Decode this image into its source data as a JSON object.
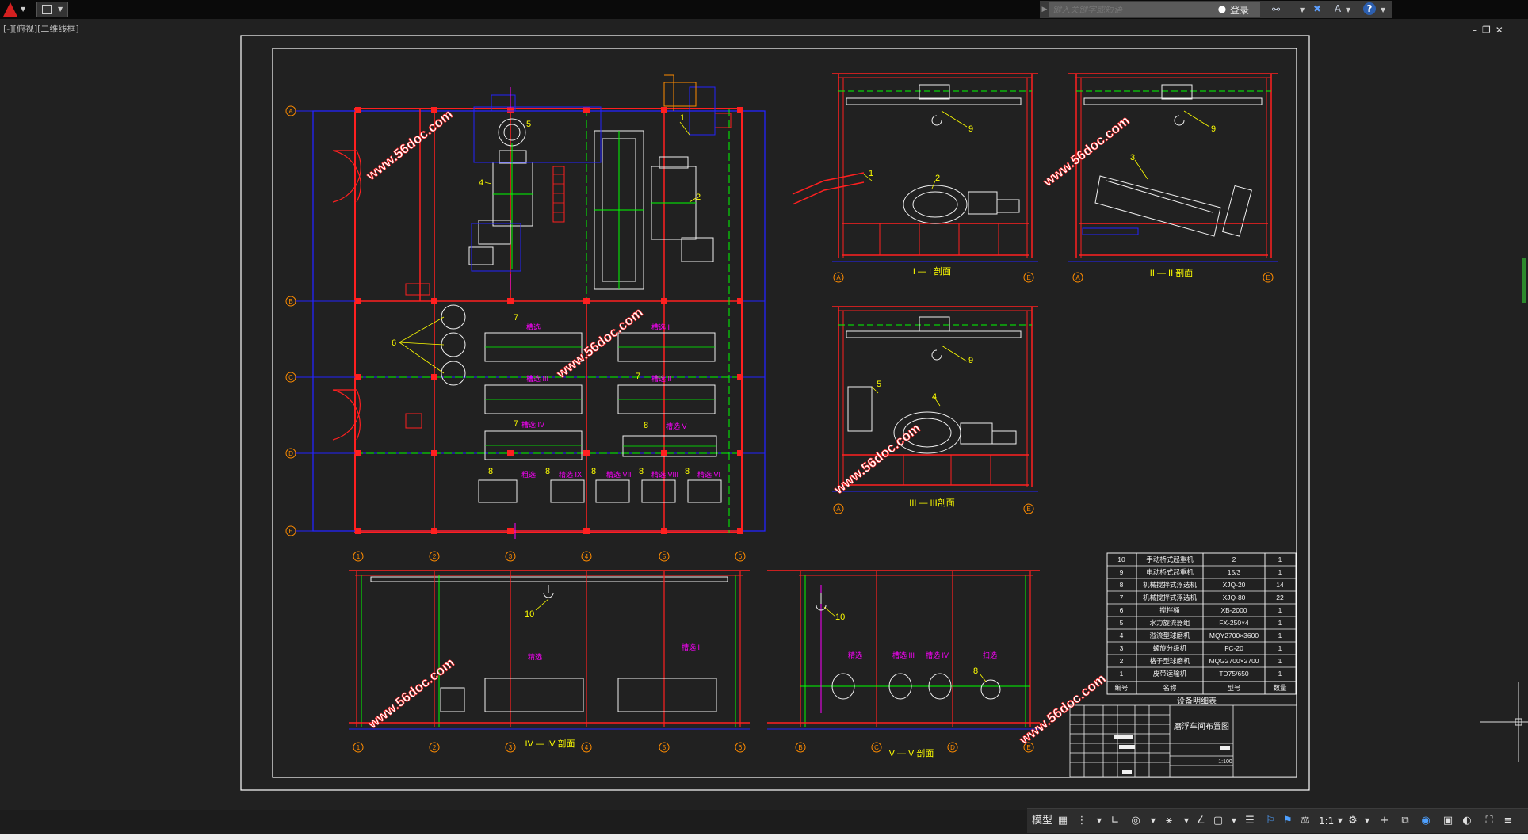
{
  "toolbar": {
    "search_placeholder": "键入关键字或短语",
    "login_label": "登录"
  },
  "viewport_label": "[-][俯视][二维线框]",
  "window_controls": [
    "–",
    "❐",
    "✕"
  ],
  "plan": {
    "grid_rows": [
      "A",
      "B",
      "C",
      "D",
      "E"
    ],
    "grid_cols": [
      "1",
      "2",
      "3",
      "4",
      "5",
      "6"
    ],
    "callouts": [
      "1",
      "2",
      "4",
      "5",
      "6",
      "7",
      "7",
      "7",
      "8",
      "8",
      "8",
      "8",
      "8",
      "8"
    ],
    "tank_labels": [
      "槽选",
      "槽选 I",
      "槽选 II",
      "槽选 III",
      "槽选 IV",
      "槽选 V",
      "粗选",
      "精选 IX",
      "精选 VII",
      "精选 VIII",
      "精选 VI"
    ]
  },
  "sections": {
    "s1": {
      "title": "I — I 剖面",
      "callouts": [
        "1",
        "2",
        "9"
      ],
      "axes": [
        "A",
        "E"
      ]
    },
    "s2": {
      "title": "II — II 剖面",
      "callouts": [
        "3",
        "9"
      ],
      "axes": [
        "A",
        "E"
      ]
    },
    "s3": {
      "title": "III — III剖面",
      "callouts": [
        "4",
        "5",
        "9"
      ],
      "axes": [
        "A",
        "E"
      ]
    },
    "s4": {
      "title": "IV — IV 剖面",
      "callouts": [
        "10"
      ],
      "labels": [
        "精选",
        "槽选 I"
      ],
      "axes": [
        "1",
        "2",
        "3",
        "4",
        "5",
        "6"
      ]
    },
    "s5": {
      "title": "V — V 剖面",
      "callouts": [
        "10",
        "8"
      ],
      "labels": [
        "精选",
        "槽选 III",
        "槽选 IV",
        "扫选"
      ],
      "axes": [
        "B",
        "C",
        "D",
        "E"
      ]
    }
  },
  "equipment_table": {
    "title": "设备明细表",
    "headers": [
      "编号",
      "名称",
      "型号",
      "数量"
    ],
    "rows": [
      [
        "10",
        "手动桥式起重机",
        "2",
        "1"
      ],
      [
        "9",
        "电动桥式起重机",
        "15/3",
        "1"
      ],
      [
        "8",
        "机械搅拌式浮选机",
        "XJQ-20",
        "14"
      ],
      [
        "7",
        "机械搅拌式浮选机",
        "XJQ-80",
        "22"
      ],
      [
        "6",
        "搅拌桶",
        "XB-2000",
        "1"
      ],
      [
        "5",
        "水力旋流器组",
        "FX-250×4",
        "1"
      ],
      [
        "4",
        "溢流型球磨机",
        "MQY2700×3600",
        "1"
      ],
      [
        "3",
        "螺旋分级机",
        "FC-20",
        "1"
      ],
      [
        "2",
        "格子型球磨机",
        "MQG2700×2700",
        "1"
      ],
      [
        "1",
        "皮带运输机",
        "TD75/650",
        "1"
      ]
    ]
  },
  "title_block": {
    "drawing_name": "磨浮车间布置图",
    "scale": "1:100"
  },
  "watermark": "www.56doc.com",
  "statusbar": {
    "model_label": "模型",
    "scale_label": "1:1"
  },
  "colors": {
    "background": "#212121",
    "frame": "#ffffff",
    "walls": "#ff2020",
    "grid": "#1a1aff",
    "equipment": "#f0f0f0",
    "leader": "#ffff00",
    "axis_text": "#ff8c00",
    "watermark": "#ffffff",
    "accent": "#00ff00",
    "magenta": "#ff00ff",
    "cyan": "#00ffff"
  }
}
